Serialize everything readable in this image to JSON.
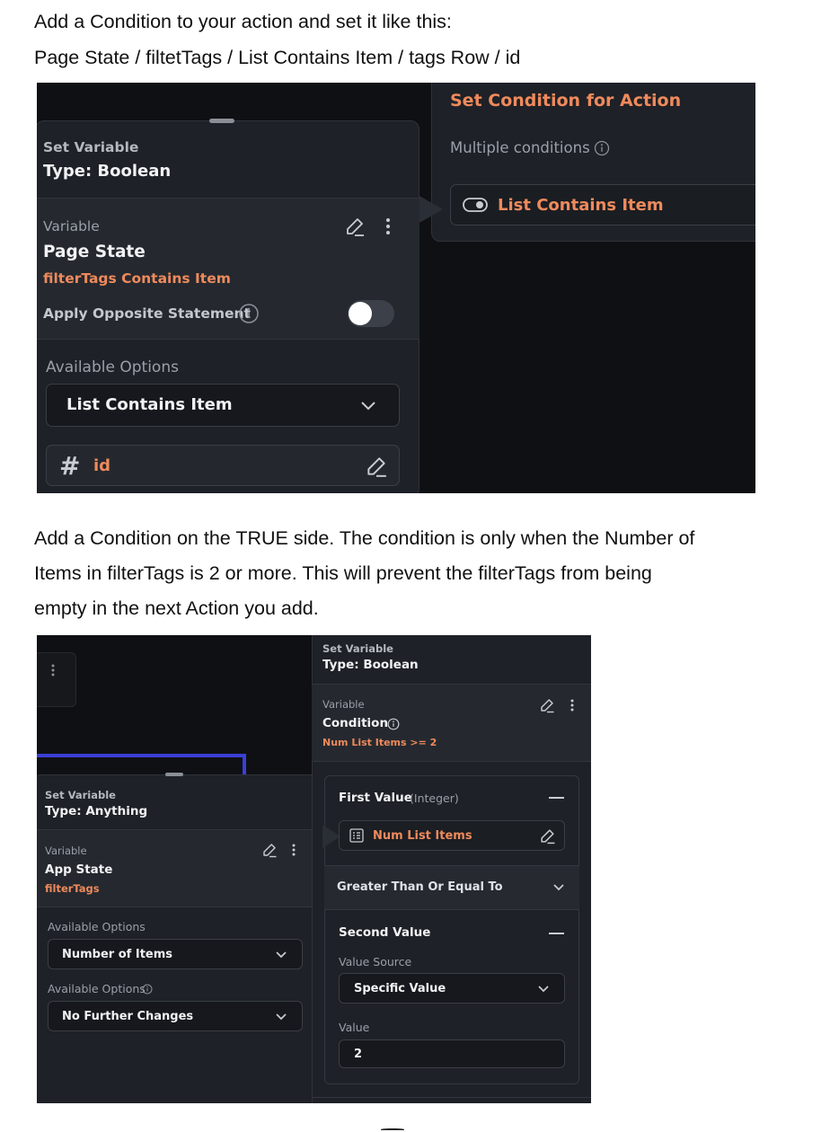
{
  "doc": {
    "line1": "Add a Condition to your action and set it like this:",
    "line2": "Page State / filtetTags / List Contains Item / tags Row / id",
    "para2": [
      "Add a Condition on the TRUE side. The condition is only when the Number of",
      "Items in filterTags is 2 or more. This will prevent the filterTags from being",
      "empty in the next Action you add."
    ]
  },
  "shot1": {
    "card": {
      "header_label": "Set Variable",
      "header_type": "Type: Boolean",
      "variable_label": "Variable",
      "variable_value": "Page State",
      "variable_sub": "filterTags Contains Item",
      "opposite_label": "Apply Opposite Statement",
      "opposite_toggle": "on",
      "options_label": "Available Options",
      "options_value": "List Contains Item",
      "id_glyph": "#",
      "id_value": "id"
    },
    "condition": {
      "title": "Set Condition for Action",
      "multiple_label": "Multiple conditions",
      "chip_label": "List Contains Item"
    }
  },
  "shot2": {
    "left": {
      "header_label": "Set Variable",
      "header_type": "Type: Anything",
      "variable_label": "Variable",
      "variable_value": "App State",
      "variable_sub": "filterTags",
      "options1_label": "Available Options",
      "options1_value": "Number of Items",
      "options2_label": "Available Options",
      "options2_value": "No Further Changes"
    },
    "right": {
      "header_label": "Set Variable",
      "header_type": "Type: Boolean",
      "variable_label": "Variable",
      "variable_value": "Condition",
      "variable_sub": "Num List Items >= 2",
      "first_value_label": "First Value",
      "first_value_type": "(Integer)",
      "first_value_chip": "Num List Items",
      "operator": "Greater Than Or Equal To",
      "second_value_label": "Second Value",
      "value_source_label": "Value Source",
      "value_source": "Specific Value",
      "value_label": "Value",
      "value": "2"
    }
  },
  "colors": {
    "accent_orange": "#ef8a5c",
    "panel_bg": "#1e2127",
    "screenshot_bg": "#0f1014",
    "connector_purple": "#3a3fd6"
  },
  "icons": [
    "edit-pencil-icon",
    "more-vert-icon",
    "info-icon",
    "chevron-down-icon",
    "hash-icon",
    "toggle-icon",
    "list-icon",
    "minus-icon"
  ]
}
